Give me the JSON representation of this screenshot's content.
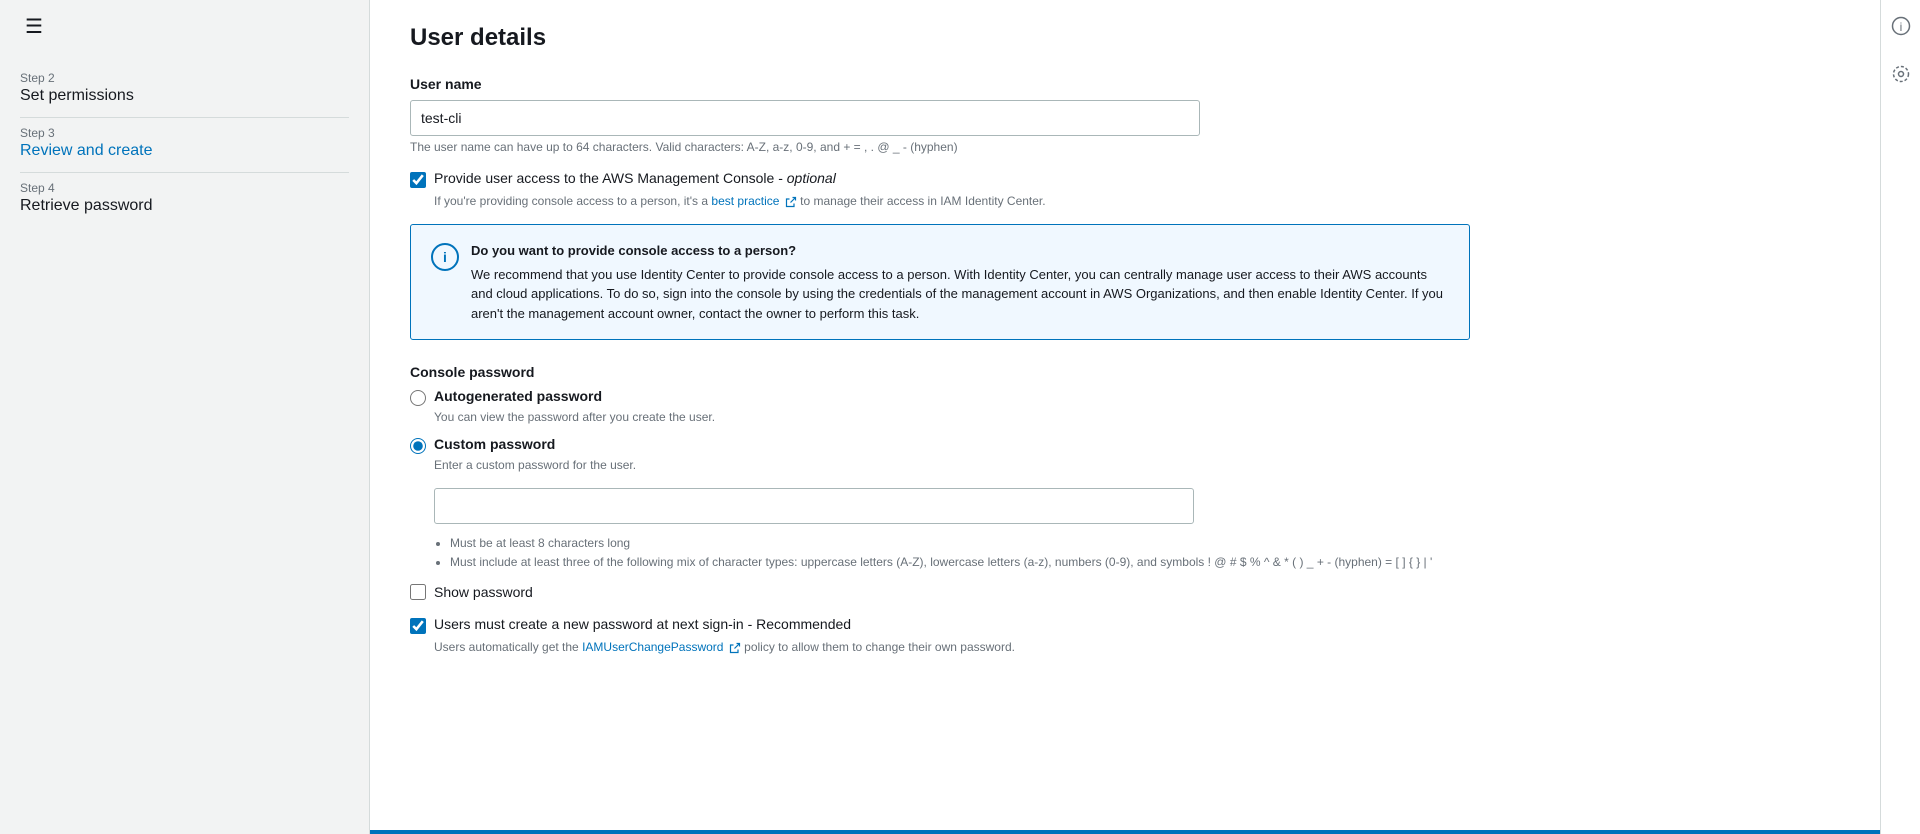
{
  "sidebar": {
    "hamburger": "☰",
    "steps": [
      {
        "id": "step2",
        "label": "Step 2",
        "title": "Set permissions",
        "active": false
      },
      {
        "id": "step3",
        "label": "Step 3",
        "title": "Review and create",
        "active": false
      },
      {
        "id": "step4",
        "label": "Step 4",
        "title": "Retrieve password",
        "active": false
      }
    ]
  },
  "right_icons": {
    "info": "ⓘ",
    "settings": "◎"
  },
  "main": {
    "page_title": "User details",
    "username_label": "User name",
    "username_value": "test-cli",
    "username_hint": "The user name can have up to 64 characters. Valid characters: A-Z, a-z, 0-9, and + = , . @ _ - (hyphen)",
    "console_access_label": "Provide user access to the AWS Management Console - ",
    "console_access_optional": "optional",
    "best_practice_prefix": "If you're providing console access to a person, it's a ",
    "best_practice_link": "best practice",
    "best_practice_suffix": " to manage their access in IAM Identity Center.",
    "info_box": {
      "title": "Do you want to provide console access to a person?",
      "body": "We recommend that you use Identity Center to provide console access to a person. With Identity Center, you can centrally manage user access to their AWS accounts and cloud applications. To do so, sign into the console by using the credentials of the management account in AWS Organizations, and then enable Identity Center. If you aren't the management account owner, contact the owner to perform this task."
    },
    "console_password_label": "Console password",
    "autogenerated_label": "Autogenerated password",
    "autogenerated_hint": "You can view the password after you create the user.",
    "custom_password_label": "Custom password",
    "custom_password_hint": "Enter a custom password for the user.",
    "password_rules": [
      "Must be at least 8 characters long",
      "Must include at least three of the following mix of character types: uppercase letters (A-Z), lowercase letters (a-z), numbers (0-9), and symbols ! @ # $ % ^ & * ( ) _ + - (hyphen) = [ ] { } | '"
    ],
    "show_password_label": "Show password",
    "must_change_label": "Users must create a new password at next sign-in - Recommended",
    "must_change_hint_prefix": "Users automatically get the ",
    "must_change_hint_link": "IAMUserChangePassword",
    "must_change_hint_suffix": " policy to allow them to change their own password."
  }
}
